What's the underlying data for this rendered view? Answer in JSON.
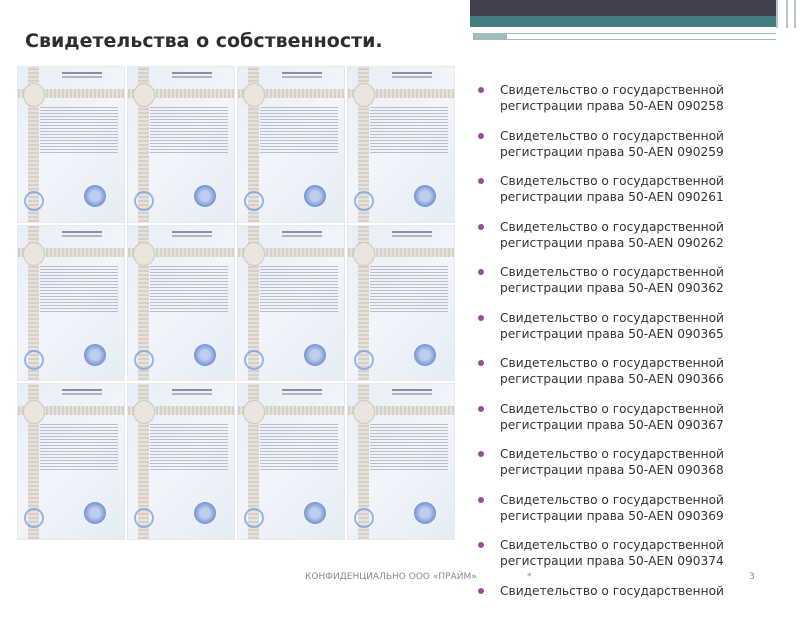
{
  "title": "Свидетельства о собственности.",
  "certificates_count": 12,
  "items": [
    {
      "line1": "Свидетельство о государственной",
      "line2": "регистрации права 50-AEN  090258"
    },
    {
      "line1": "Свидетельство о государственной",
      "line2": "регистрации права 50-AEN  090259"
    },
    {
      "line1": "Свидетельство о государственной",
      "line2": "регистрации права 50-AEN  090261"
    },
    {
      "line1": "Свидетельство о государственной",
      "line2": "регистрации права 50-AEN  090262"
    },
    {
      "line1": "Свидетельство о государственной",
      "line2": "регистрации права 50-AEN  090362"
    },
    {
      "line1": "Свидетельство о государственной",
      "line2": "регистрации права 50-AEN  090365"
    },
    {
      "line1": "Свидетельство о государственной",
      "line2": "регистрации права 50-AEN  090366"
    },
    {
      "line1": "Свидетельство о государственной",
      "line2": "регистрации права 50-AEN  090367"
    },
    {
      "line1": "Свидетельство о государственной",
      "line2": "регистрации права 50-AEN  090368"
    },
    {
      "line1": "Свидетельство о государственной",
      "line2": "регистрации права 50-AEN  090369"
    },
    {
      "line1": "Свидетельство о государственной",
      "line2": "регистрации права 50-AEN  090374"
    },
    {
      "line1": "Свидетельство о государственной",
      "line2": ""
    }
  ],
  "footer": {
    "company": "КОНФИДЕНЦИАЛЬНО ООО «ПРАЙМ»",
    "marker": "*",
    "page": "3"
  },
  "colors": {
    "dark_bar": "#41414f",
    "teal_bar": "#457c7f",
    "bullet": "#9a4b9e"
  }
}
